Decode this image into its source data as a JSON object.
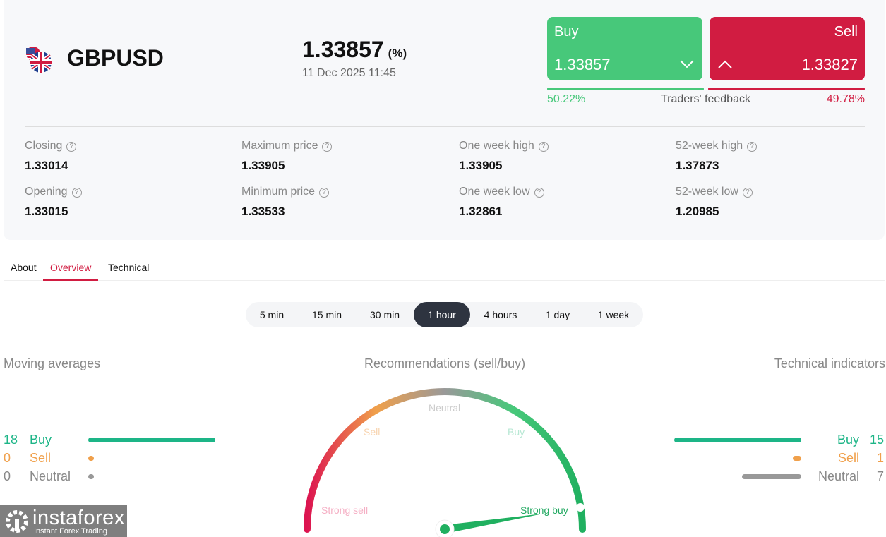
{
  "header": {
    "symbol": "GBPUSD",
    "price": "1.33857",
    "change": "(%)",
    "datetime": "11 Dec 2025 11:45",
    "flag_icon": "gb-us-flag-icon"
  },
  "buy": {
    "label": "Buy",
    "price": "1.33857"
  },
  "sell": {
    "label": "Sell",
    "price": "1.33827"
  },
  "feedback": {
    "buy_pct": "50.22%",
    "label": "Traders' feedback",
    "sell_pct": "49.78%",
    "buy_fraction": 0.5022
  },
  "stats": [
    {
      "label": "Closing",
      "value": "1.33014"
    },
    {
      "label": "Maximum price",
      "value": "1.33905"
    },
    {
      "label": "One week high",
      "value": "1.33905"
    },
    {
      "label": "52-week high",
      "value": "1.37873"
    },
    {
      "label": "Opening",
      "value": "1.33015"
    },
    {
      "label": "Minimum price",
      "value": "1.33533"
    },
    {
      "label": "One week low",
      "value": "1.32861"
    },
    {
      "label": "52-week low",
      "value": "1.20985"
    }
  ],
  "help_glyph": "?",
  "tabs": [
    "About",
    "Overview",
    "Technical"
  ],
  "periods": [
    "5 min",
    "15 min",
    "30 min",
    "1 hour",
    "4 hours",
    "1 day",
    "1 week"
  ],
  "moving_averages": {
    "title": "Moving averages",
    "rows": [
      {
        "count": "18",
        "label": "Buy",
        "value": 18
      },
      {
        "count": "0",
        "label": "Sell",
        "value": 0
      },
      {
        "count": "0",
        "label": "Neutral",
        "value": 0
      }
    ]
  },
  "recommendations": {
    "title": "Recommendations (sell/buy)",
    "labels": {
      "strong_sell": "Strong sell",
      "sell": "Sell",
      "neutral": "Neutral",
      "buy": "Buy",
      "strong_buy": "Strong buy"
    },
    "needle_fraction": 0.95
  },
  "technical_indicators": {
    "title": "Technical indicators",
    "rows": [
      {
        "count": "15",
        "label": "Buy",
        "value": 15
      },
      {
        "count": "1",
        "label": "Sell",
        "value": 1
      },
      {
        "count": "7",
        "label": "Neutral",
        "value": 7
      }
    ]
  },
  "logo": {
    "name": "instaforex",
    "tagline": "Instant Forex Trading"
  },
  "colors": {
    "buy": "#47c87a",
    "sell": "#d11c41",
    "green": "#1db587",
    "orange": "#f0a04b",
    "gray": "#999999"
  }
}
